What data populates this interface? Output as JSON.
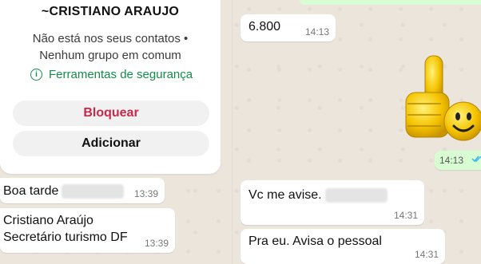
{
  "contact_card": {
    "name": "~CRISTIANO ARAUJO",
    "info_line1": "Não está nos seus contatos •",
    "info_line2": "Nenhum grupo em comum",
    "security_label": "Ferramentas de segurança",
    "block_label": "Bloquear",
    "add_label": "Adicionar"
  },
  "incoming_left": [
    {
      "text": "Boa tarde",
      "time": "13:39"
    },
    {
      "line1": "Cristiano Araújo",
      "line2": "Secretário turismo DF",
      "time": "13:39"
    }
  ],
  "incoming_right": [
    {
      "text": "6.800",
      "time": "14:13"
    },
    {
      "text": "Vc me avise.",
      "time": "14:31"
    },
    {
      "text": "Pra eu. Avisa o pessoal",
      "time": "14:31"
    }
  ],
  "outgoing": {
    "time": "14:13",
    "status_icon": "double-check-icon"
  },
  "sticker": {
    "icon": "thumbs-up-smiley-sticker"
  },
  "colors": {
    "accent_green": "#128c4a",
    "block_red": "#c52a4c",
    "outgoing_bg": "#d9fdd3",
    "chat_bg": "#ece5dc",
    "check_blue": "#34b7f1"
  }
}
